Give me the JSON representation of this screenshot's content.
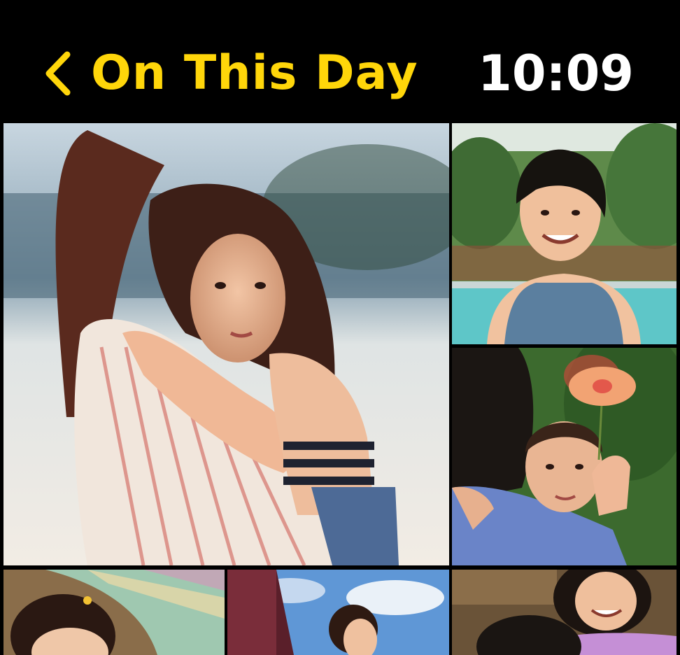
{
  "nav": {
    "back_label": "On This Day",
    "time": "10:09"
  },
  "colors": {
    "accent": "#FFD60A",
    "background": "#000000",
    "time_text": "#FFFFFF"
  },
  "photos": [
    {
      "id": "photo-mother-daughter-hug",
      "subject": "woman hugging young girl at the beach"
    },
    {
      "id": "photo-boy-pool",
      "subject": "smiling boy by a pool"
    },
    {
      "id": "photo-girl-flower",
      "subject": "girl holding a hibiscus flower while hugging a man"
    },
    {
      "id": "photo-girl-hammock",
      "subject": "girl in a hammock"
    },
    {
      "id": "photo-girl-sky",
      "subject": "girl under a blue sky"
    },
    {
      "id": "photo-woman-smiling",
      "subject": "smiling woman in purple"
    }
  ]
}
